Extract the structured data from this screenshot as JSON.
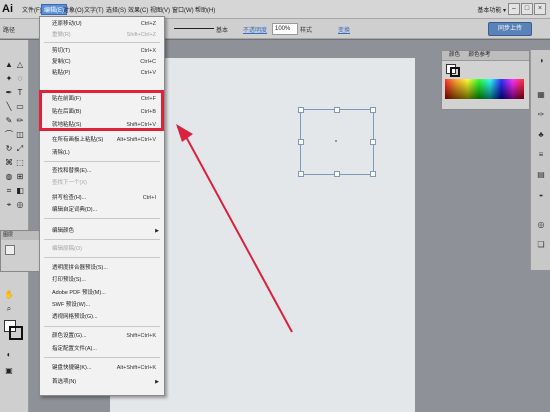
{
  "app": {
    "logo": "Ai",
    "workspace": "基本功能 ▾"
  },
  "menubar": [
    "文件(F)",
    "编辑(E)",
    "对象(O)",
    "文字(T)",
    "选择(S)",
    "效果(C)",
    "视图(V)",
    "窗口(W)",
    "帮助(H)"
  ],
  "control_bar": {
    "left_label": "路径",
    "stroke_profile": "基本",
    "opacity_label": "不透明度",
    "opacity_value": "100%",
    "style_label": "样式",
    "transform_label": "变换",
    "sync_label": "同步上传"
  },
  "color_panel": {
    "tab1": "颜色",
    "tab2": "颜色参考"
  },
  "layers_panel": {
    "tab": "图层"
  },
  "edit_menu": [
    {
      "label": "还原移动(U)",
      "shortcut": "Ctrl+Z",
      "disabled": false
    },
    {
      "label": "重做(R)",
      "shortcut": "Shift+Ctrl+Z",
      "disabled": true
    },
    {
      "label": "剪切(T)",
      "shortcut": "Ctrl+X",
      "disabled": false
    },
    {
      "label": "复制(C)",
      "shortcut": "Ctrl+C",
      "disabled": false
    },
    {
      "label": "粘贴(P)",
      "shortcut": "Ctrl+V",
      "disabled": false
    },
    {
      "label": "贴在前面(F)",
      "shortcut": "Ctrl+F",
      "disabled": false
    },
    {
      "label": "贴在后面(B)",
      "shortcut": "Ctrl+B",
      "disabled": false
    },
    {
      "label": "就地粘贴(S)",
      "shortcut": "Shift+Ctrl+V",
      "disabled": false
    },
    {
      "label": "在所有画板上粘贴(S)",
      "shortcut": "Alt+Shift+Ctrl+V",
      "disabled": false
    },
    {
      "label": "清除(L)",
      "shortcut": "",
      "disabled": false
    },
    {
      "label": "查找和替换(E)...",
      "shortcut": "",
      "disabled": false
    },
    {
      "label": "查找下一个(X)",
      "shortcut": "",
      "disabled": true
    },
    {
      "label": "拼写检查(H)...",
      "shortcut": "Ctrl+I",
      "disabled": false
    },
    {
      "label": "编辑自定词典(D)...",
      "shortcut": "",
      "disabled": false
    },
    {
      "label": "编辑颜色",
      "shortcut": "",
      "disabled": false,
      "submenu": true
    },
    {
      "label": "编辑原稿(O)",
      "shortcut": "",
      "disabled": true
    },
    {
      "label": "透明度拼合器预设(S)...",
      "shortcut": "",
      "disabled": false
    },
    {
      "label": "打印预设(S)...",
      "shortcut": "",
      "disabled": false
    },
    {
      "label": "Adobe PDF 预设(M)...",
      "shortcut": "",
      "disabled": false
    },
    {
      "label": "SWF 预设(W)...",
      "shortcut": "",
      "disabled": false
    },
    {
      "label": "透视网格预设(G)...",
      "shortcut": "",
      "disabled": false
    },
    {
      "label": "颜色设置(G)...",
      "shortcut": "Shift+Ctrl+K",
      "disabled": false
    },
    {
      "label": "指定配置文件(A)...",
      "shortcut": "",
      "disabled": false
    },
    {
      "label": "键盘快捷键(K)...",
      "shortcut": "Alt+Shift+Ctrl+K",
      "disabled": false
    },
    {
      "label": "首选项(N)",
      "shortcut": "",
      "disabled": false,
      "submenu": true
    }
  ],
  "colors": {
    "highlight": "#e0213a",
    "arrow": "#d9223f",
    "selection": "#7e9ab9"
  },
  "icons": {
    "close": "close-icon",
    "minimize": "minimize-icon",
    "maximize": "maximize-icon"
  }
}
